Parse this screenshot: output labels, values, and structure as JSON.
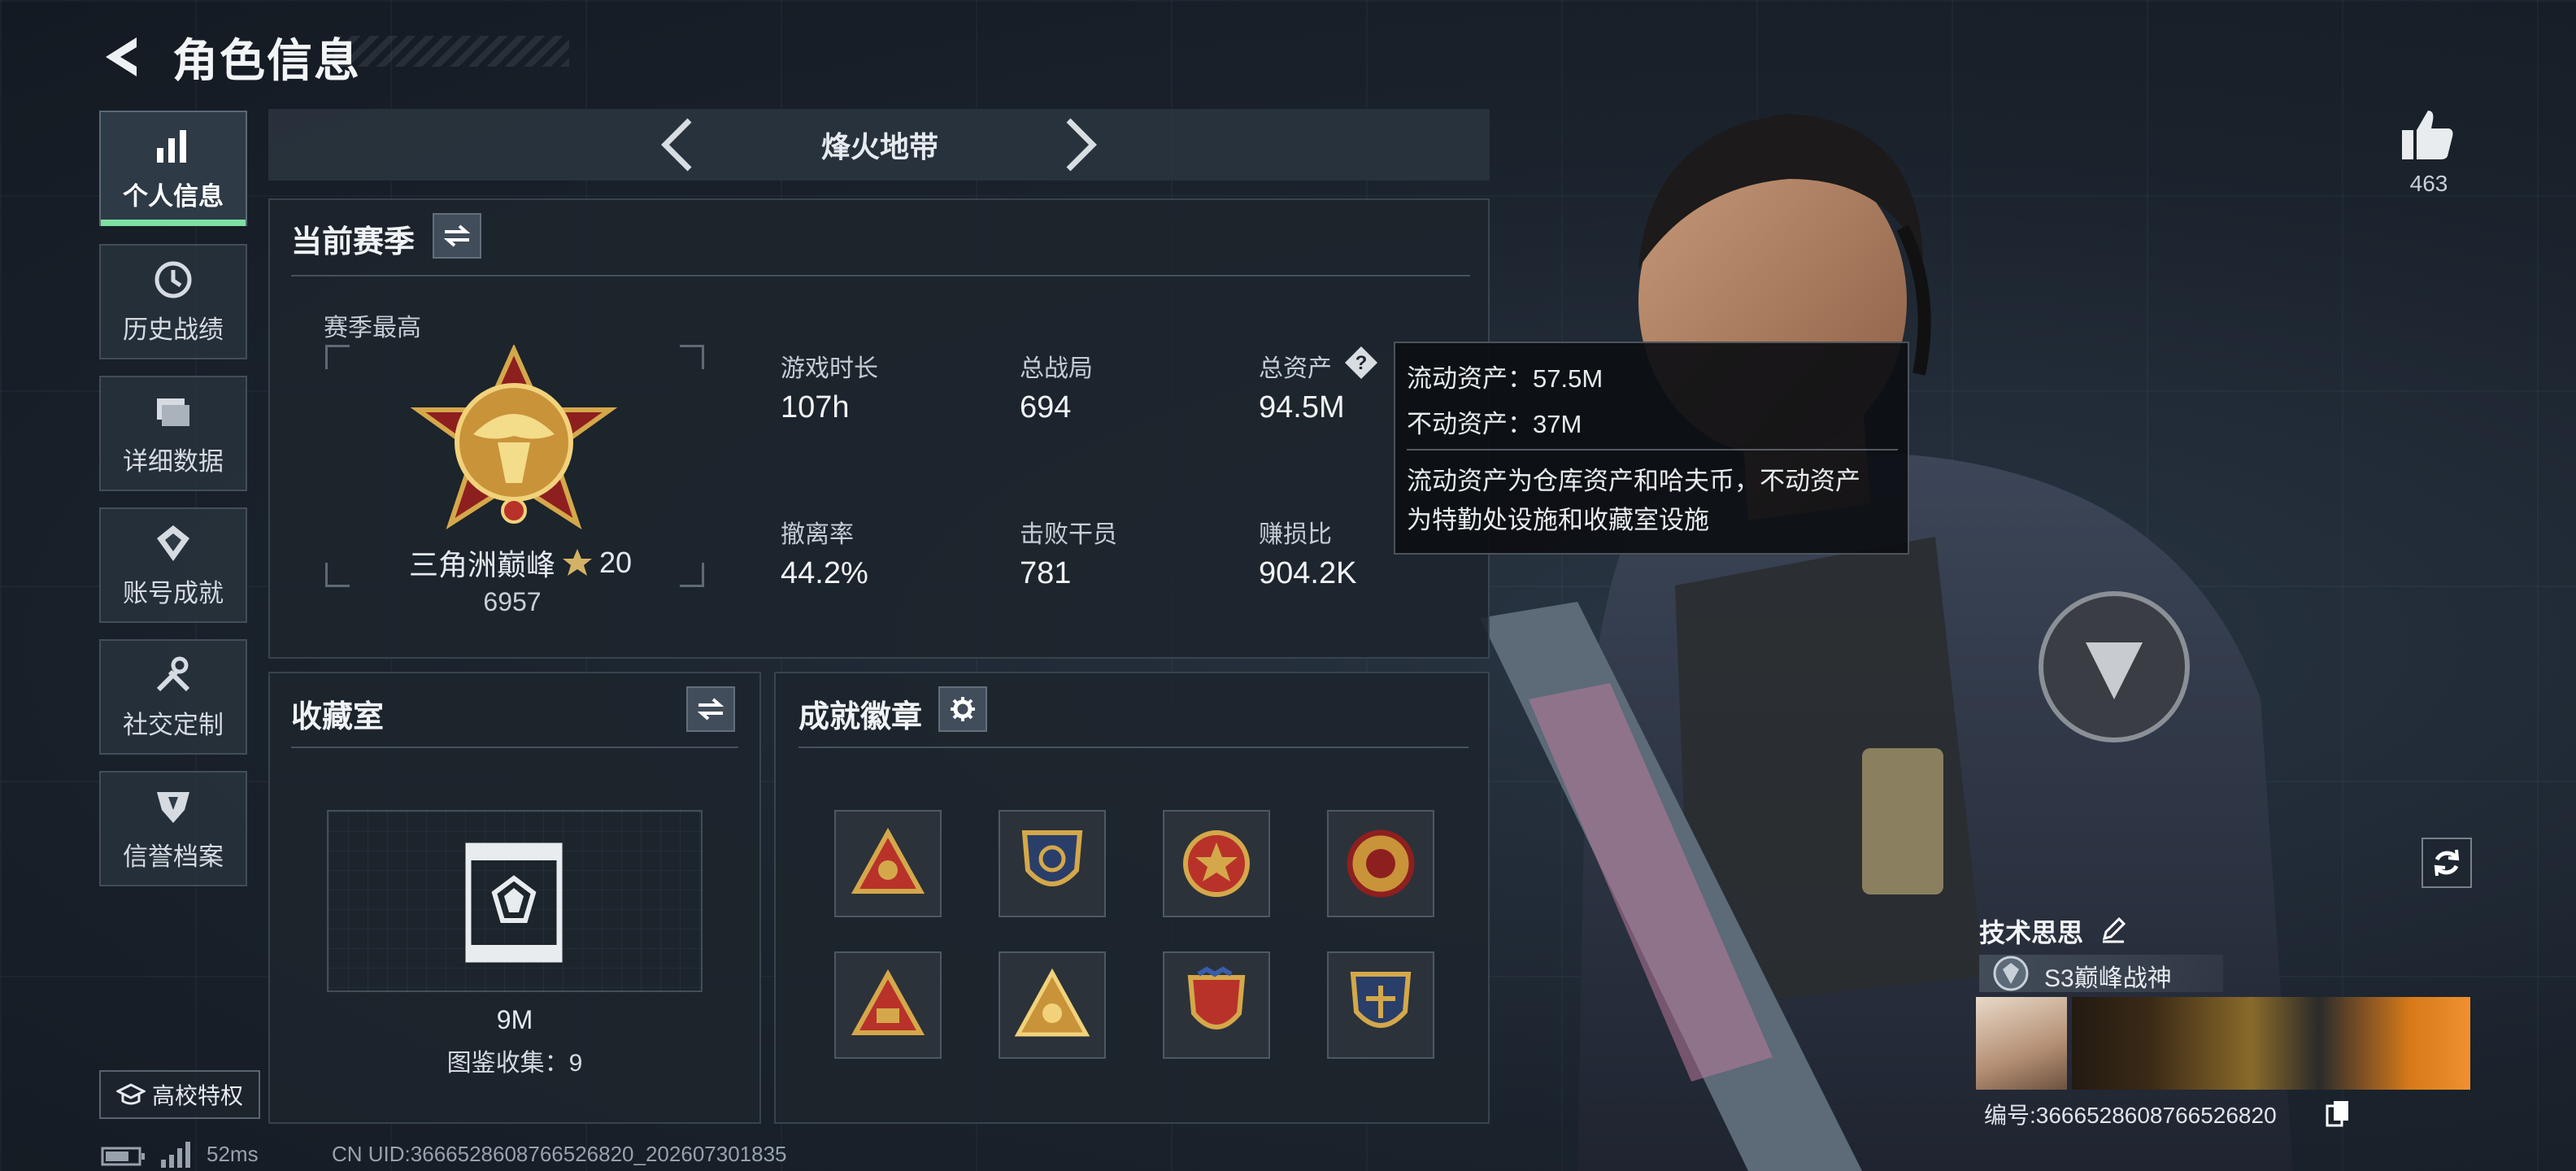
{
  "header": {
    "title": "角色信息"
  },
  "nav": {
    "items": [
      {
        "label": "个人信息"
      },
      {
        "label": "历史战绩"
      },
      {
        "label": "详细数据"
      },
      {
        "label": "账号成就"
      },
      {
        "label": "社交定制"
      },
      {
        "label": "信誉档案"
      }
    ],
    "campus_label": "高校特权"
  },
  "mode": {
    "label": "烽火地带"
  },
  "season": {
    "title": "当前赛季",
    "best_label": "赛季最高",
    "rank_name": "三角洲巅峰",
    "rank_stars": "20",
    "rank_score": "6957",
    "stats": [
      {
        "label": "游戏时长",
        "value": "107h"
      },
      {
        "label": "总战局",
        "value": "694"
      },
      {
        "label": "总资产",
        "value": "94.5M"
      },
      {
        "label": "撤离率",
        "value": "44.2%"
      },
      {
        "label": "击败干员",
        "value": "781"
      },
      {
        "label": "赚损比",
        "value": "904.2K"
      }
    ]
  },
  "tooltip": {
    "line1": "流动资产：57.5M",
    "line2": "不动资产：37M",
    "desc1": "流动资产为仓库资产和哈夫币，不动资产",
    "desc2": "为特勤处设施和收藏室设施"
  },
  "collection": {
    "title": "收藏室",
    "value": "9M",
    "count_text": "图鉴收集：9"
  },
  "badges": {
    "title": "成就徽章"
  },
  "likes": {
    "count": "463"
  },
  "player": {
    "name": "技术思思",
    "title": "S3巅峰战神",
    "id_text": "编号:3666528608766526820"
  },
  "footer": {
    "ping": "52ms",
    "uid": "CN UID:3666528608766526820_202607301835"
  },
  "colors": {
    "accent_green": "#7ee0a0",
    "gold": "#d4a84a",
    "badge_red": "#b8322a"
  }
}
